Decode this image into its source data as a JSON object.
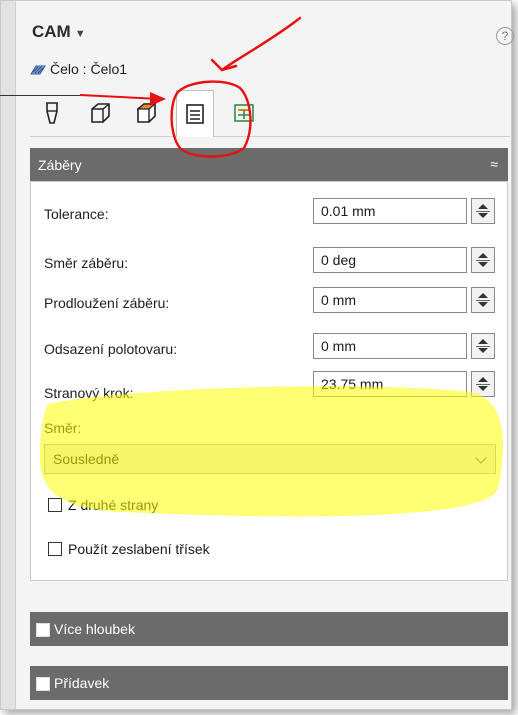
{
  "header": {
    "title": "CAM",
    "help": "?"
  },
  "operation": {
    "name": "Čelo : Čelo1"
  },
  "tabs": [
    {
      "name": "tool-tab"
    },
    {
      "name": "geometry-tab"
    },
    {
      "name": "heights-tab"
    },
    {
      "name": "passes-tab",
      "active": true
    },
    {
      "name": "linking-tab"
    }
  ],
  "passes_section": {
    "label": "Záběry",
    "fields": {
      "tolerance": {
        "label": "Tolerance:",
        "value": "0.01 mm"
      },
      "pass_direction": {
        "label": "Směr záběru:",
        "value": "0 deg"
      },
      "pass_extension": {
        "label": "Prodloužení záběru:",
        "value": "0 mm"
      },
      "stock_offset": {
        "label": "Odsazení polotovaru:",
        "value": "0 mm"
      },
      "stepover": {
        "label": "Stranový krok:",
        "value": "23.75 mm"
      }
    },
    "direction": {
      "label": "Směr:",
      "value": "Sousledně"
    },
    "other_side": {
      "label": "Z druhé strany"
    },
    "chip_thinning": {
      "label": "Použít zeslabení třísek"
    }
  },
  "multiple_depths_section": {
    "label": "Více hloubek"
  },
  "stock_to_leave_section": {
    "label": "Přídavek"
  },
  "colors": {
    "section_bg": "#6b6b6b",
    "highlight": "#ffff00",
    "annotation": "#e81010"
  }
}
